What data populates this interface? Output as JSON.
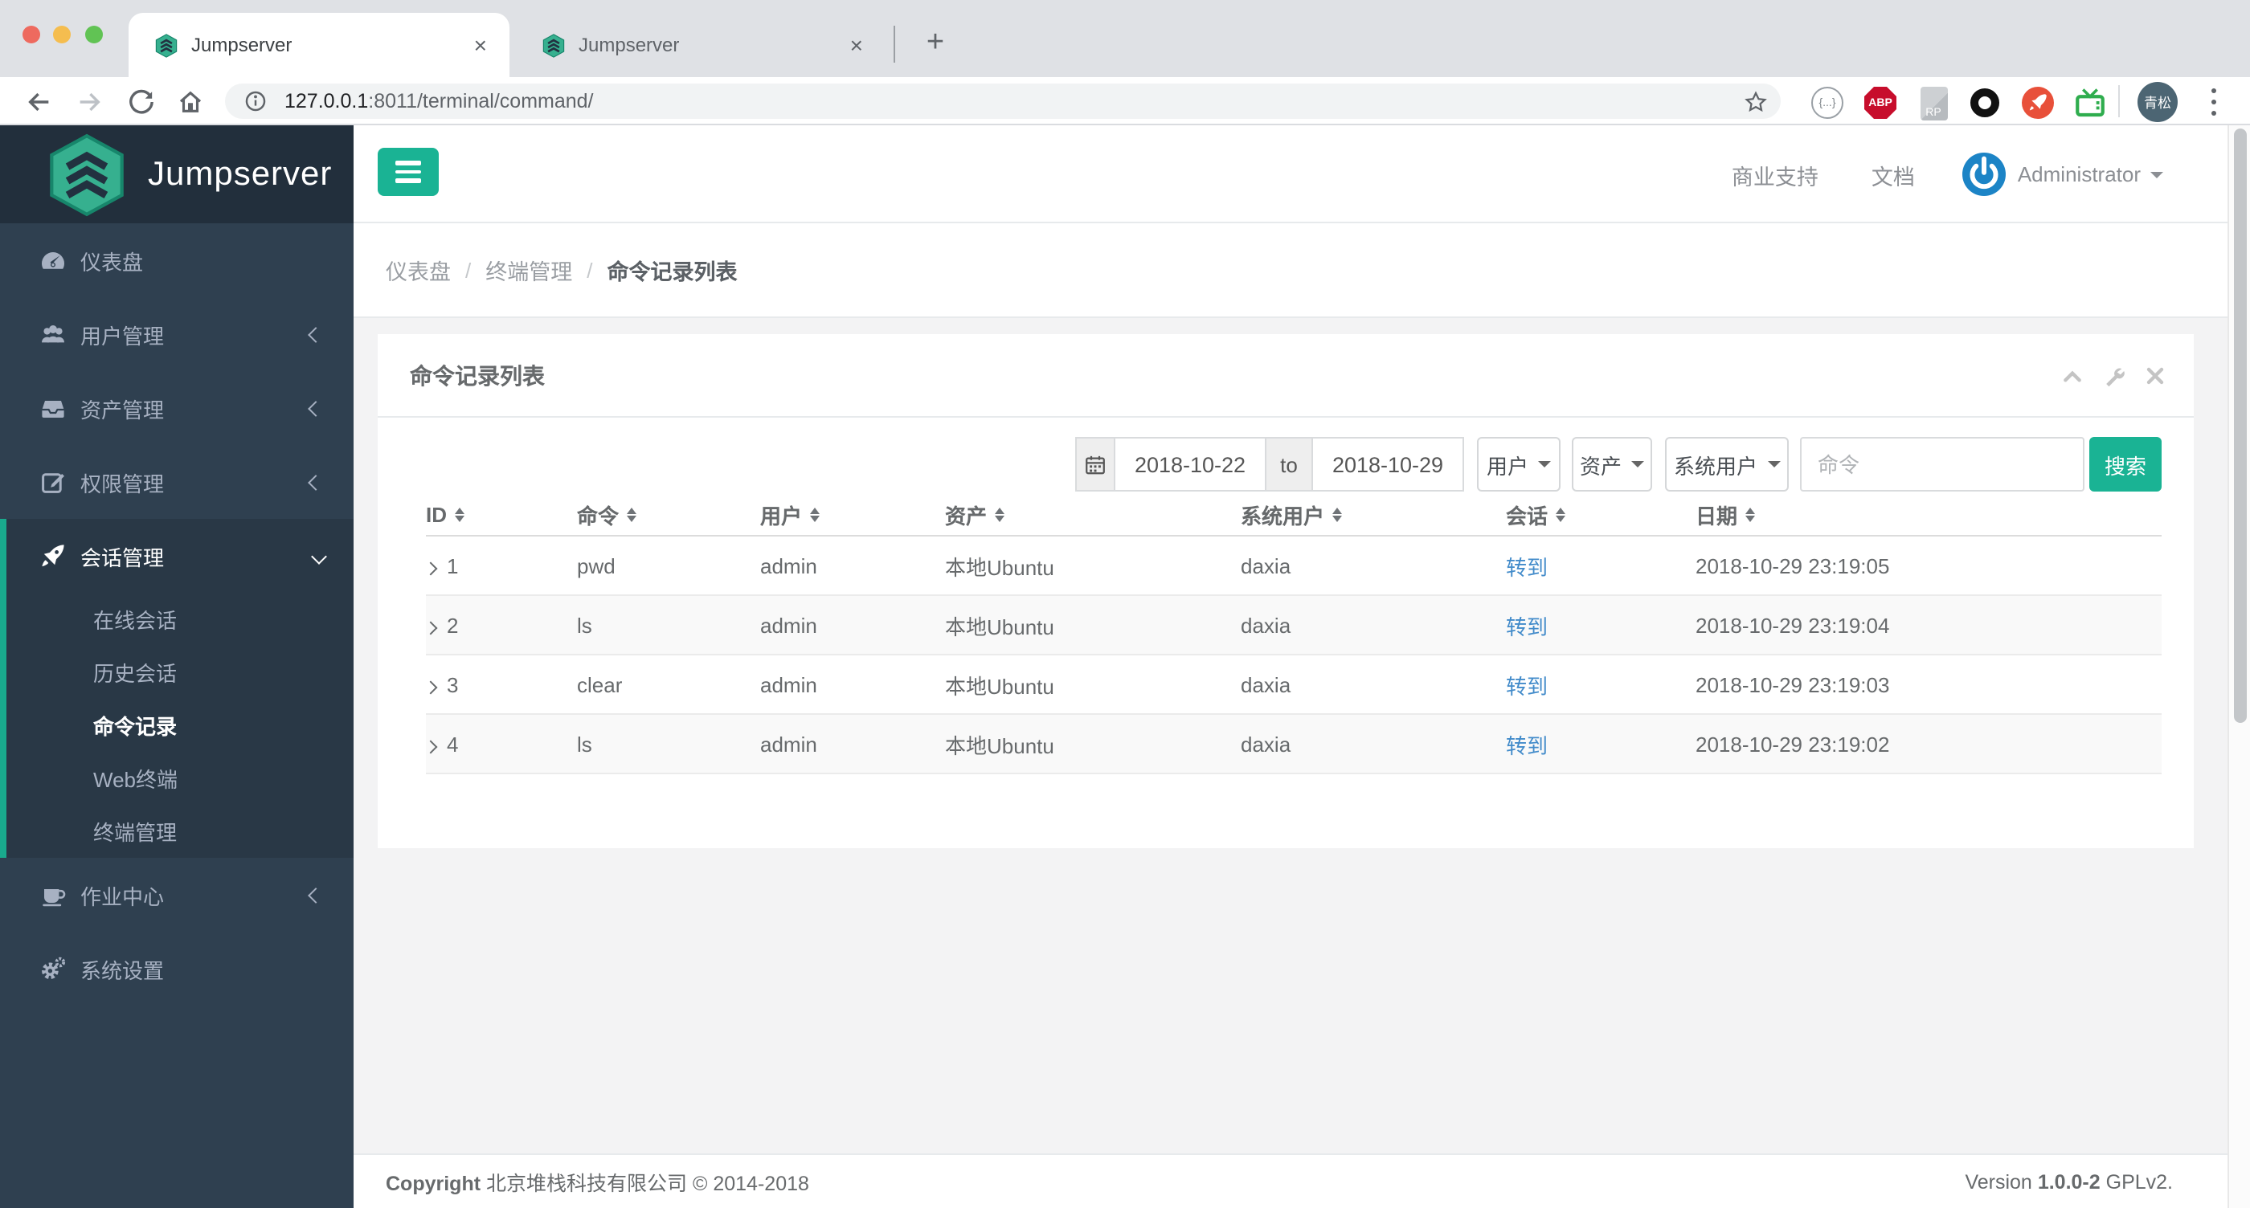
{
  "browser": {
    "tabs": [
      {
        "title": "Jumpserver"
      },
      {
        "title": "Jumpserver"
      }
    ],
    "url": {
      "host": "127.0.0.1",
      "rest": ":8011/terminal/command/"
    },
    "extensions": {
      "json_viewer": "{...}",
      "adblock": "ABP",
      "rp": "RP"
    },
    "profile_badge": "青松"
  },
  "topbar": {
    "support": "商业支持",
    "docs": "文档",
    "user": "Administrator"
  },
  "sidebar": {
    "logo_text": "Jumpserver",
    "items": [
      {
        "label": "仪表盘"
      },
      {
        "label": "用户管理"
      },
      {
        "label": "资产管理"
      },
      {
        "label": "权限管理"
      },
      {
        "label": "会话管理",
        "children": [
          "在线会话",
          "历史会话",
          "命令记录",
          "Web终端",
          "终端管理"
        ],
        "active_child": "命令记录"
      },
      {
        "label": "作业中心"
      },
      {
        "label": "系统设置"
      }
    ]
  },
  "breadcrumb": {
    "items": [
      "仪表盘",
      "终端管理"
    ],
    "current": "命令记录列表"
  },
  "panel": {
    "title": "命令记录列表"
  },
  "filters": {
    "date_from": "2018-10-22",
    "to_label": "to",
    "date_to": "2018-10-29",
    "user_dropdown": "用户",
    "asset_dropdown": "资产",
    "system_user_dropdown": "系统用户",
    "command_placeholder": "命令",
    "search_label": "搜索"
  },
  "table": {
    "columns": [
      "ID",
      "命令",
      "用户",
      "资产",
      "系统用户",
      "会话",
      "日期"
    ],
    "rows": [
      {
        "id": "1",
        "command": "pwd",
        "user": "admin",
        "asset": "本地Ubuntu",
        "system_user": "daxia",
        "session": "转到",
        "date": "2018-10-29 23:19:05"
      },
      {
        "id": "2",
        "command": "ls",
        "user": "admin",
        "asset": "本地Ubuntu",
        "system_user": "daxia",
        "session": "转到",
        "date": "2018-10-29 23:19:04"
      },
      {
        "id": "3",
        "command": "clear",
        "user": "admin",
        "asset": "本地Ubuntu",
        "system_user": "daxia",
        "session": "转到",
        "date": "2018-10-29 23:19:03"
      },
      {
        "id": "4",
        "command": "ls",
        "user": "admin",
        "asset": "本地Ubuntu",
        "system_user": "daxia",
        "session": "转到",
        "date": "2018-10-29 23:19:02"
      }
    ]
  },
  "footer": {
    "copyright_label": "Copyright",
    "company": "北京堆栈科技有限公司 © 2014-2018",
    "version_label": "Version",
    "version": "1.0.0-2",
    "license": "GPLv2."
  },
  "colors": {
    "accent": "#1ab394",
    "sidebar": "#2f4050",
    "sidebar_header": "#222f3c",
    "active_indicator": "#19aa8d",
    "link": "#428bca",
    "content_bg": "#f3f3f4"
  }
}
